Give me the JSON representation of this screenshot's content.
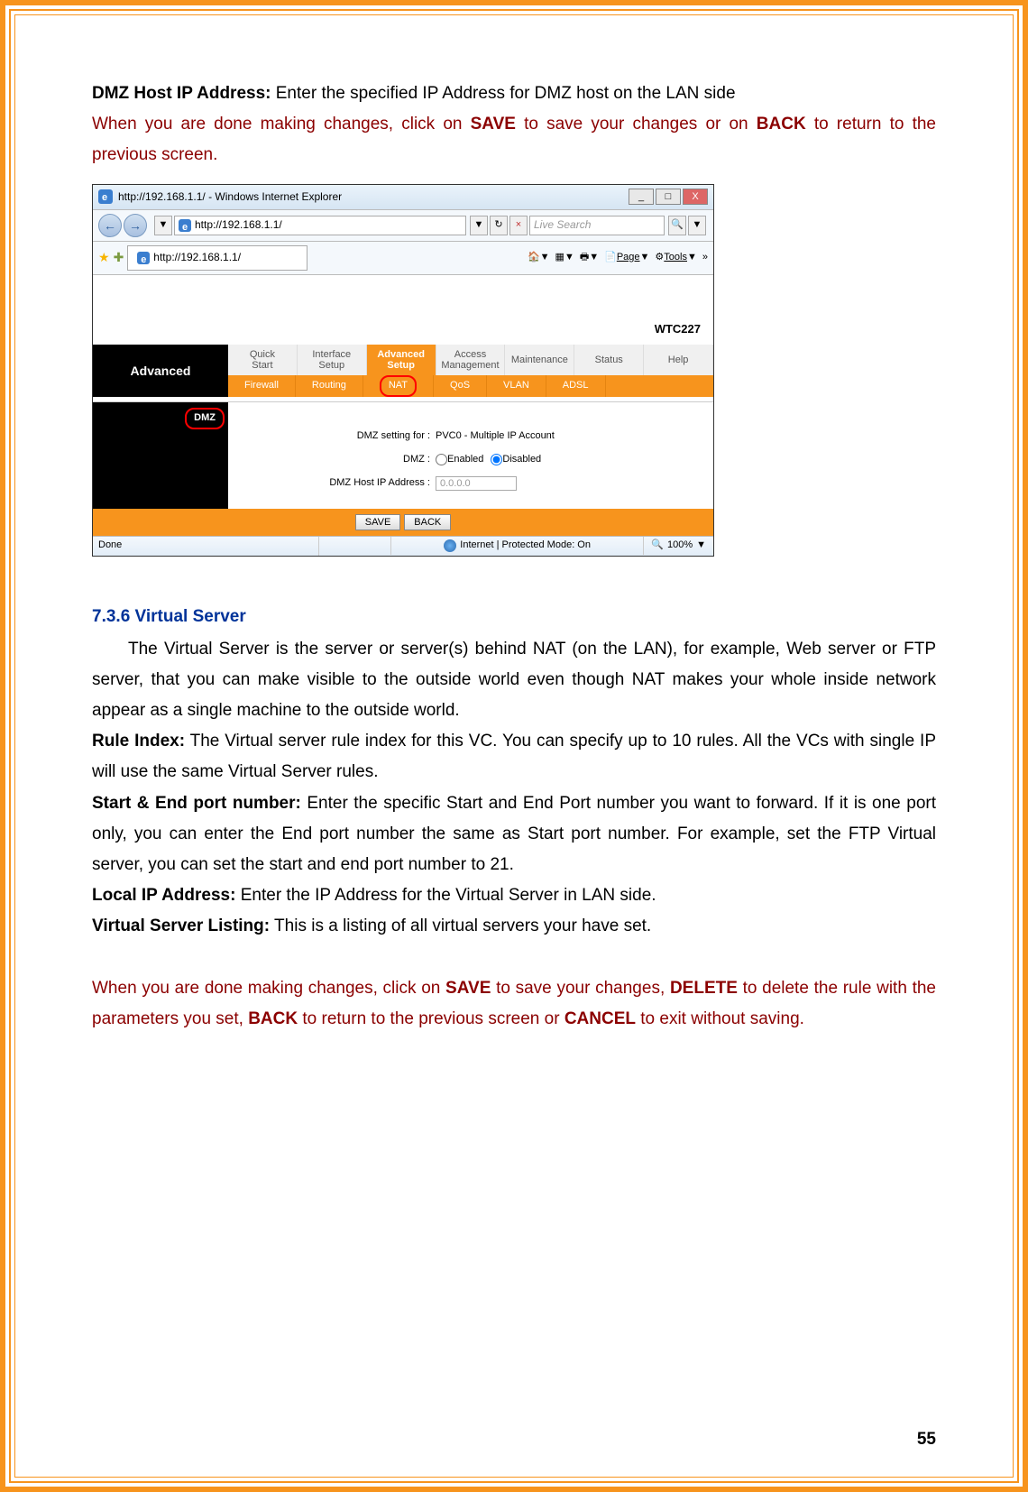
{
  "p1": {
    "label": "DMZ Host IP Address:",
    "text": " Enter the specified IP Address for DMZ host on the LAN side"
  },
  "p2": {
    "pre": "When you are done making changes, click on ",
    "save": "SAVE",
    "mid": " to save your changes or on ",
    "back": "BACK",
    "post": " to return to the previous screen."
  },
  "screenshot": {
    "title": "http://192.168.1.1/ - Windows Internet Explorer",
    "win_min": "_",
    "win_max": "□",
    "win_close": "X",
    "back_arrow": "←",
    "fwd_arrow": "→",
    "url": "http://192.168.1.1/",
    "dropdown": "▼",
    "refresh": "↻",
    "stop": "×",
    "search_placeholder": "Live Search",
    "search_icon": "🔍",
    "star1": "★",
    "star2": "✚",
    "tab_label": "http://192.168.1.1/",
    "tool_home": "🏠",
    "tool_feed": "▦",
    "tool_print": "🖶",
    "tool_page": "Page",
    "tool_tools": "Tools",
    "brand": "WTC227",
    "nav_title": "Advanced",
    "main_tabs": {
      "t0": "Quick\nStart",
      "t1": "Interface\nSetup",
      "t2": "Advanced\nSetup",
      "t3": "Access\nManagement",
      "t4": "Maintenance",
      "t5": "Status",
      "t6": "Help"
    },
    "sub_tabs": {
      "s0": "Firewall",
      "s1": "Routing",
      "s2": "NAT",
      "s3": "QoS",
      "s4": "VLAN",
      "s5": "ADSL"
    },
    "dmz_left": "DMZ",
    "dmz_setting_label": "DMZ setting for :",
    "dmz_setting_value": "PVC0 - Multiple IP Account",
    "dmz_label": "DMZ :",
    "dmz_enabled": "Enabled",
    "dmz_disabled": "Disabled",
    "dmz_ip_label": "DMZ Host IP Address :",
    "dmz_ip_value": "0.0.0.0",
    "save_btn": "SAVE",
    "back_btn": "BACK",
    "status_done": "Done",
    "status_mode": "Internet | Protected Mode: On",
    "status_zoom": "100%",
    "status_drop": "▼"
  },
  "heading": "7.3.6 Virtual Server",
  "p3": "The Virtual Server is the server or server(s) behind NAT (on the LAN), for example, Web server or FTP server, that you can make visible to the outside world even though NAT makes your whole inside network appear as a single machine to the outside world.",
  "p4": {
    "label": "Rule Index:",
    "text": "   The Virtual server rule index for this VC. You can specify up to 10 rules. All the VCs with single IP will use the same Virtual Server rules."
  },
  "p5": {
    "label": "Start & End port number:",
    "text": "   Enter the specific Start and End Port number you want to forward. If it is one port only, you can enter the End port number the same as Start port number. For example, set the FTP Virtual server, you can set the start and end port number to 21."
  },
  "p6": {
    "label": "Local IP Address:",
    "text": " Enter the IP Address for the Virtual Server in LAN side."
  },
  "p7": {
    "label": "Virtual Server Listing:",
    "text": " This is a listing of all virtual servers your have set."
  },
  "p8": {
    "pre": "When you are done making changes, click on ",
    "save": "SAVE",
    "mid1": " to save your changes, ",
    "delete": "DELETE",
    "mid2": " to delete the rule with the parameters you set, ",
    "back": "BACK",
    "mid3": " to return to the previous screen or ",
    "cancel": "CANCEL",
    "post": " to exit without saving."
  },
  "page_number": "55"
}
